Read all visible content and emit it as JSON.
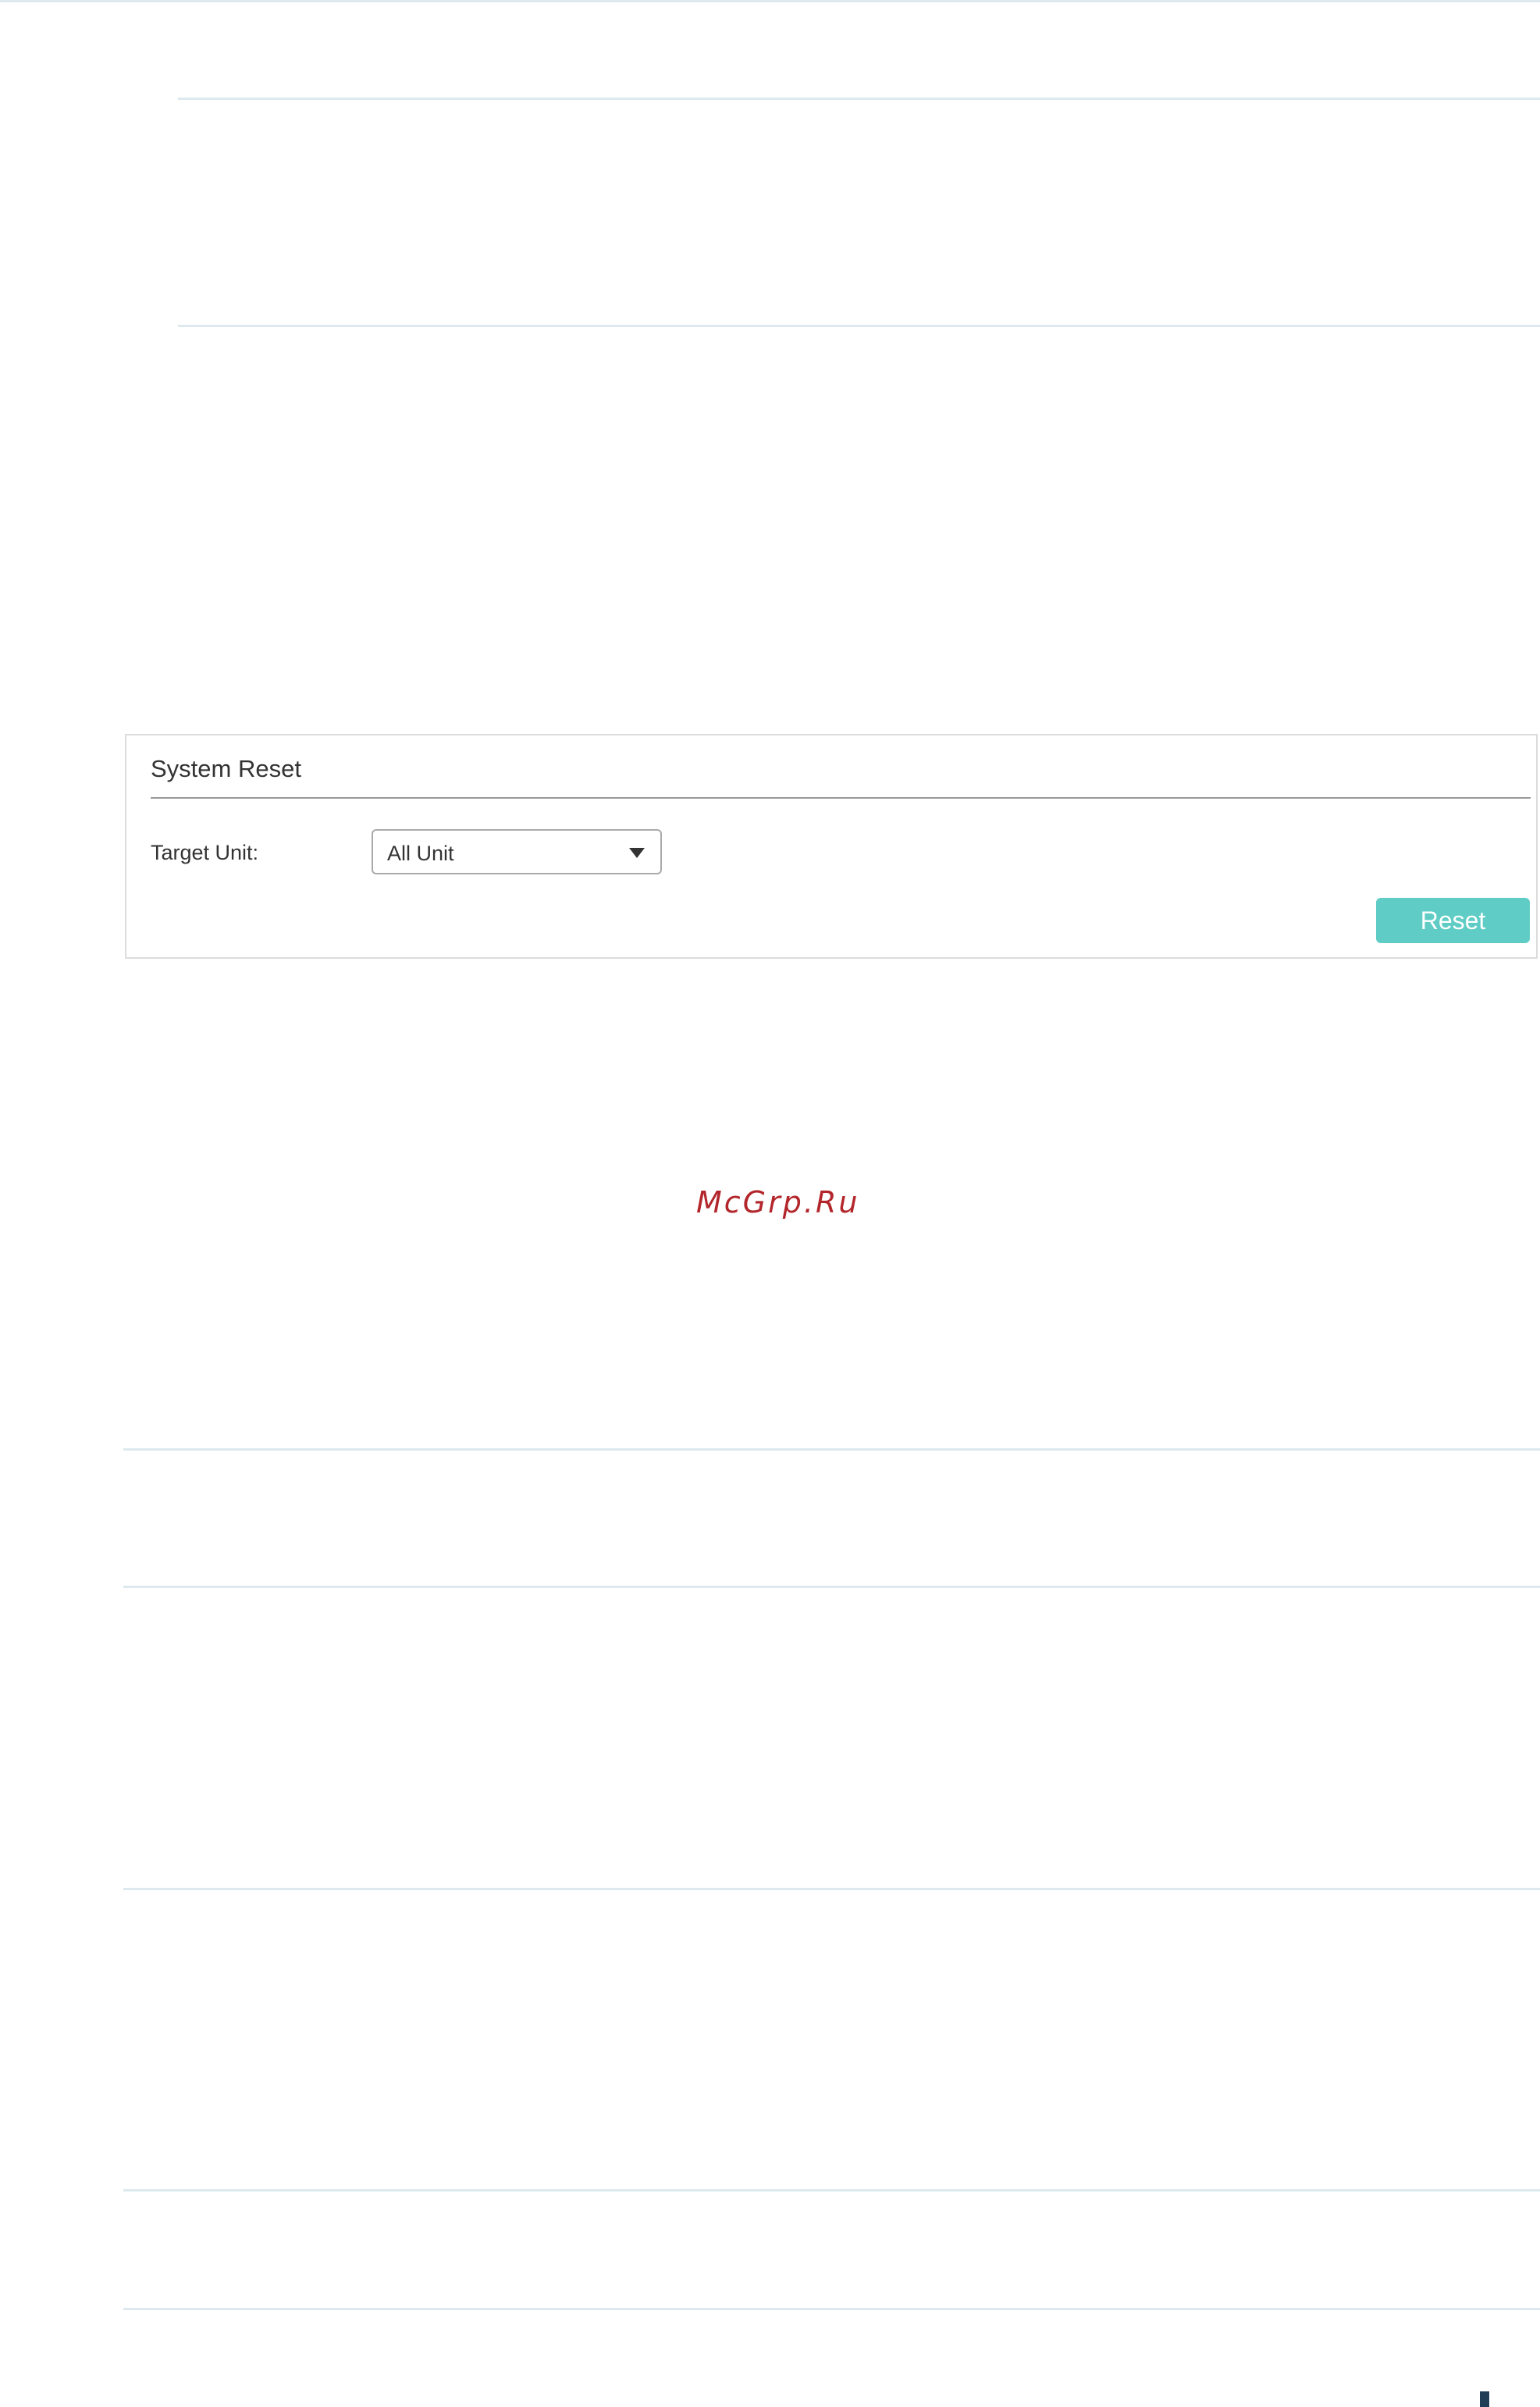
{
  "system_reset": {
    "title": "System Reset",
    "target_unit_label": "Target Unit:",
    "target_unit_value": "All Unit",
    "reset_label": "Reset"
  },
  "watermark": "McGrp.Ru"
}
